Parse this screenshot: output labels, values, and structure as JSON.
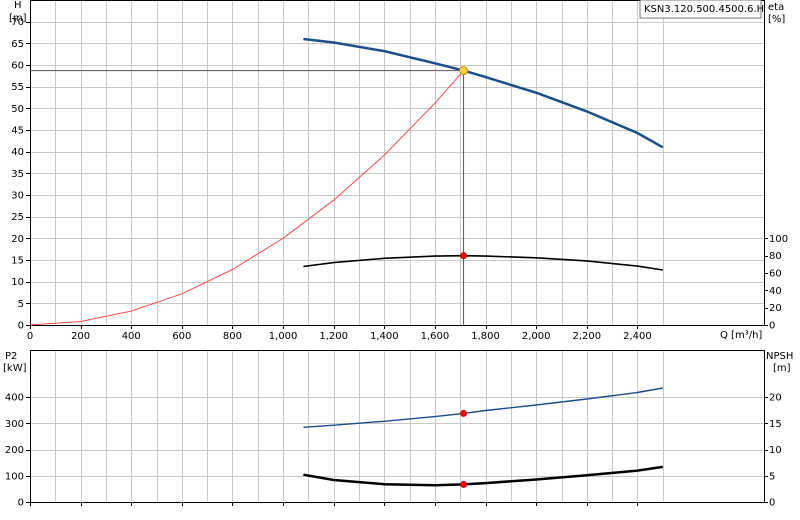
{
  "chart_data": [
    {
      "type": "line",
      "title": "KSN3.120.500.4500.6.H",
      "xlabel": "Q [m³/h]",
      "xlim": [
        0,
        2900
      ],
      "xticks": [
        0,
        200,
        400,
        600,
        800,
        1000,
        1200,
        1400,
        1600,
        1800,
        2000,
        2200,
        2400
      ],
      "xtick_labels": [
        "0",
        "200",
        "400",
        "600",
        "800",
        "1,000",
        "1,200",
        "1,400",
        "1,600",
        "1,800",
        "2,000",
        "2,200",
        "2,400"
      ],
      "ylabel_left": [
        "H",
        "[m]"
      ],
      "ylim_left": [
        0,
        75
      ],
      "yticks_left": [
        0,
        5,
        10,
        15,
        20,
        25,
        30,
        35,
        40,
        45,
        50,
        55,
        60,
        65,
        70
      ],
      "ylabel_right": [
        "eta",
        "[%]"
      ],
      "ylim_right": [
        0,
        375
      ],
      "yticks_right": [
        0,
        20,
        40,
        60,
        80,
        100
      ],
      "grid": true,
      "series": [
        {
          "axis": "left",
          "color": "#1c4d8c",
          "x": [
            1080,
            1200,
            1400,
            1600,
            1713,
            1800,
            2000,
            2200,
            2400,
            2500
          ],
          "y": [
            66,
            65.2,
            63.2,
            60.4,
            58.7,
            57.2,
            53.6,
            49.3,
            44.3,
            41
          ]
        },
        {
          "axis": "left",
          "color": "#ff4a4a",
          "x": [
            0,
            200,
            400,
            600,
            800,
            1000,
            1200,
            1400,
            1600,
            1713
          ],
          "y": [
            0,
            0.8,
            3.2,
            7.2,
            12.8,
            20,
            28.8,
            39.2,
            51.2,
            58.7
          ]
        },
        {
          "axis": "right",
          "color": "#000000",
          "x": [
            1080,
            1200,
            1400,
            1600,
            1713,
            1800,
            2000,
            2200,
            2400,
            2500
          ],
          "y": [
            67.5,
            72,
            77,
            79.5,
            80,
            79.5,
            77.5,
            74,
            68,
            63.5
          ]
        }
      ],
      "duty_point": {
        "x": 1713,
        "y": 58.7,
        "eta": 80
      },
      "markers": [
        {
          "axis": "left",
          "x": 1713,
          "y": 58.7,
          "color": "#ffd24a"
        },
        {
          "axis": "right",
          "x": 1713,
          "y": 80,
          "color": "#ff0000"
        }
      ]
    },
    {
      "type": "line",
      "xlim": [
        0,
        2900
      ],
      "xticks": [
        0,
        200,
        400,
        600,
        800,
        1000,
        1200,
        1400,
        1600,
        1800,
        2000,
        2200,
        2400
      ],
      "ylabel_left": [
        "P2",
        "[kW]"
      ],
      "ylim_left": [
        0,
        580
      ],
      "yticks_left": [
        0,
        100,
        200,
        300,
        400
      ],
      "ylabel_right": [
        "NPSH",
        "[m]"
      ],
      "ylim_right": [
        0,
        29
      ],
      "yticks_right": [
        0,
        5,
        10,
        15,
        20
      ],
      "grid": true,
      "series": [
        {
          "axis": "left",
          "color": "#1c4d8c",
          "x": [
            1080,
            1200,
            1400,
            1600,
            1713,
            1800,
            2000,
            2200,
            2400,
            2500
          ],
          "y": [
            285,
            293,
            308,
            326,
            338,
            349,
            370,
            393,
            418,
            435
          ]
        },
        {
          "axis": "right",
          "color": "#000000",
          "x": [
            1080,
            1200,
            1400,
            1600,
            1713,
            1800,
            2000,
            2200,
            2400,
            2500
          ],
          "y": [
            5.2,
            4.2,
            3.4,
            3.2,
            3.35,
            3.6,
            4.3,
            5.1,
            6.0,
            6.7
          ]
        }
      ],
      "markers": [
        {
          "axis": "left",
          "x": 1713,
          "y": 338,
          "color": "#ff0000"
        },
        {
          "axis": "right",
          "x": 1713,
          "y": 3.35,
          "color": "#ff0000"
        }
      ]
    }
  ]
}
